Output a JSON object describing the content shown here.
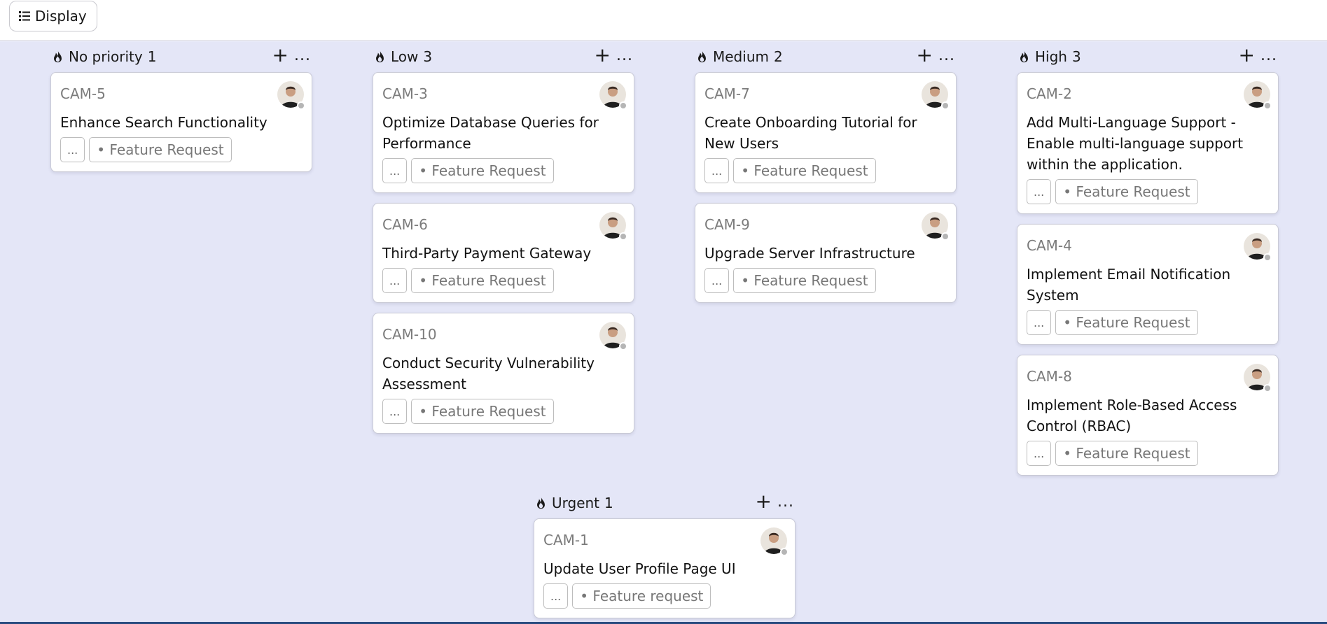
{
  "toolbar": {
    "display_label": "Display"
  },
  "columns": [
    {
      "title": "No priority",
      "count": "1",
      "cards": [
        {
          "id": "CAM-5",
          "title": "Enhance Search Functionality",
          "more": "...",
          "tag": "• Feature Request"
        }
      ]
    },
    {
      "title": "Low",
      "count": "3",
      "cards": [
        {
          "id": "CAM-3",
          "title": "Optimize Database Queries for Performance",
          "more": "...",
          "tag": "• Feature Request"
        },
        {
          "id": "CAM-6",
          "title": "Third-Party Payment Gateway",
          "more": "...",
          "tag": "• Feature Request"
        },
        {
          "id": "CAM-10",
          "title": "Conduct Security Vulnerability Assessment",
          "more": "...",
          "tag": "• Feature Request"
        }
      ]
    },
    {
      "title": "Medium",
      "count": "2",
      "cards": [
        {
          "id": "CAM-7",
          "title": "Create Onboarding Tutorial for New Users",
          "more": "...",
          "tag": "• Feature Request"
        },
        {
          "id": "CAM-9",
          "title": "Upgrade Server Infrastructure",
          "more": "...",
          "tag": "• Feature Request"
        }
      ]
    },
    {
      "title": "High",
      "count": "3",
      "cards": [
        {
          "id": "CAM-2",
          "title": "Add Multi-Language Support - Enable multi-language support within the application.",
          "more": "...",
          "tag": "• Feature Request"
        },
        {
          "id": "CAM-4",
          "title": "Implement Email Notification System",
          "more": "...",
          "tag": "• Feature Request"
        },
        {
          "id": "CAM-8",
          "title": "Implement Role-Based Access Control (RBAC)",
          "more": "...",
          "tag": "• Feature Request"
        }
      ]
    },
    {
      "title": "Urgent",
      "count": "1",
      "cards": [
        {
          "id": "CAM-1",
          "title": "Update User Profile Page UI",
          "more": "...",
          "tag": "• Feature request"
        }
      ]
    }
  ],
  "column_actions": {
    "plus": "+",
    "more": "..."
  },
  "icons": {
    "display": "list-icon",
    "priority": "flame-icon",
    "assignee": "avatar",
    "status_dot": "status-dot"
  },
  "colors": {
    "board_bg": "#e4e6f7",
    "bottom_line": "#2a4c80",
    "id_text": "#7b7b7b",
    "tag_text": "#777777"
  }
}
